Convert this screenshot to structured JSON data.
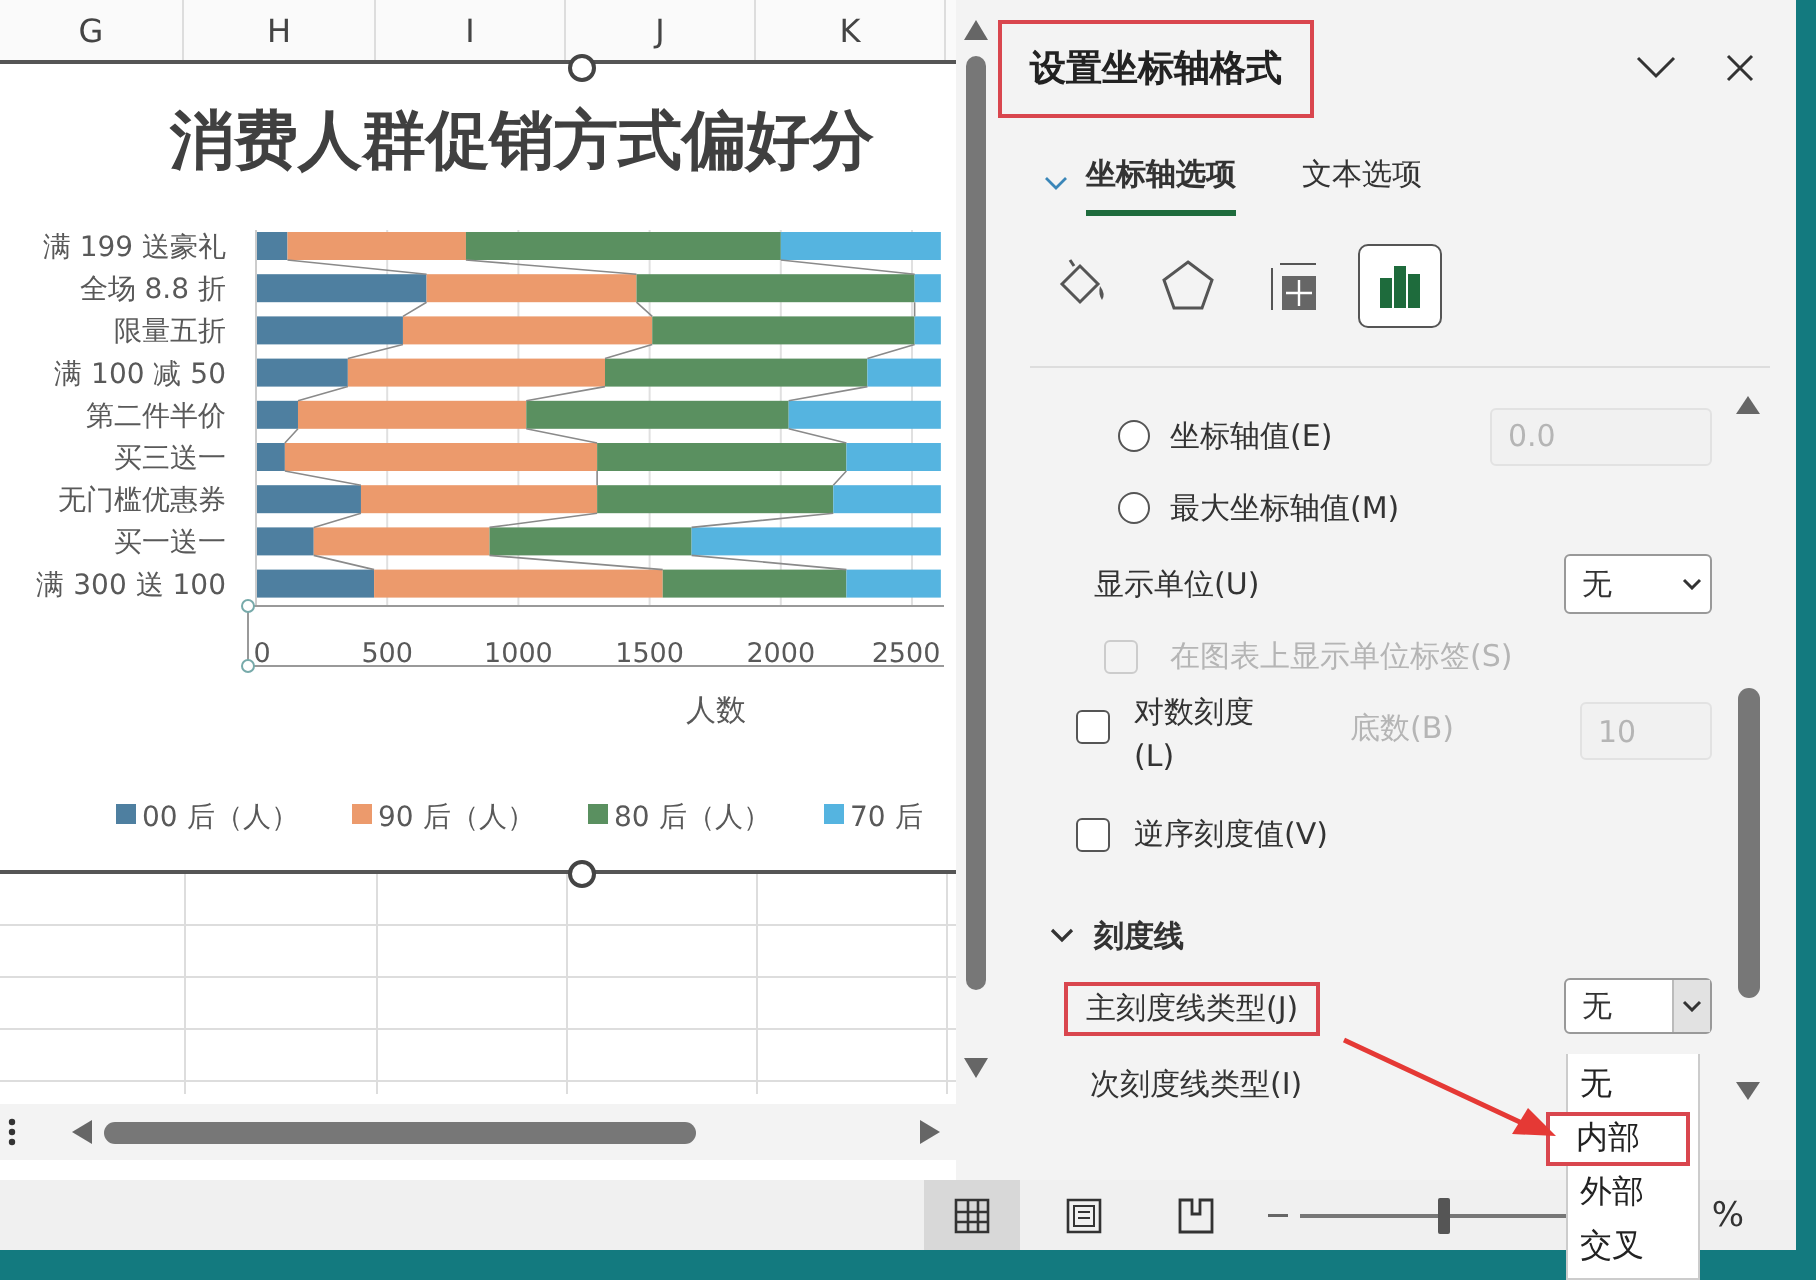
{
  "sheet": {
    "columns": [
      "G",
      "H",
      "I",
      "J",
      "K"
    ],
    "chart": {
      "chart_data": {
        "type": "bar",
        "orientation": "horizontal",
        "stacked": true,
        "title": "消费人群促销方式偏好分",
        "xlabel": "人数",
        "categories": [
          "满 199 送豪礼",
          "全场 8.8 折",
          "限量五折",
          "满 100 减 50",
          "第二件半价",
          "买三送一",
          "无门槛优惠券",
          "买一送一",
          "满 300 送 100"
        ],
        "series": [
          {
            "name": "00 后（人）",
            "color": "#4e7fa0",
            "values": [
              120,
              650,
              560,
              350,
              160,
              110,
              400,
              220,
              450
            ]
          },
          {
            "name": "90 后（人）",
            "color": "#ec9a6c",
            "values": [
              680,
              800,
              950,
              980,
              870,
              1190,
              900,
              670,
              1100
            ]
          },
          {
            "name": "80 后（人）",
            "color": "#5a9060",
            "values": [
              1200,
              1060,
              1000,
              1000,
              1000,
              950,
              900,
              770,
              700
            ]
          },
          {
            "name": "70 后",
            "color": "#55b4e0",
            "values": [
              610,
              100,
              100,
              280,
              580,
              360,
              410,
              950,
              360
            ]
          }
        ],
        "xticks": [
          0,
          500,
          1000,
          1500,
          2000,
          2500
        ],
        "xlim": [
          0,
          2610
        ],
        "grid": true,
        "legend": true
      }
    }
  },
  "pane": {
    "title": "设置坐标轴格式",
    "title_highlighted": true,
    "tabs": [
      {
        "label": "坐标轴选项",
        "selected": true
      },
      {
        "label": "文本选项",
        "selected": false
      }
    ],
    "icon_tabs": [
      {
        "kind": "fill",
        "selected": false
      },
      {
        "kind": "effects",
        "selected": false
      },
      {
        "kind": "size",
        "selected": false
      },
      {
        "kind": "axis",
        "selected": true
      }
    ],
    "options": [
      {
        "kind": "radio",
        "label": "坐标轴值(E)",
        "selected": false,
        "field": {
          "value": "0.0",
          "disabled": true
        }
      },
      {
        "kind": "radio",
        "label": "最大坐标轴值(M)",
        "selected": false
      },
      {
        "kind": "select",
        "label": "显示单位(U)",
        "value": "无",
        "highlighted": false
      },
      {
        "kind": "checkbox",
        "label": "在图表上显示单位标签(S)",
        "checked": false,
        "disabled": true
      },
      {
        "kind": "checkbox",
        "label": "对数刻度(L)",
        "checked": false,
        "disabled": false,
        "extra_label": "底数(B)",
        "field": {
          "value": "10",
          "disabled": true
        }
      },
      {
        "kind": "checkbox",
        "label": "逆序刻度值(V)",
        "checked": false,
        "disabled": false
      },
      {
        "kind": "section",
        "label": "刻度线",
        "expanded": true
      },
      {
        "kind": "select",
        "label": "主刻度线类型(J)",
        "value": "无",
        "highlighted": true
      },
      {
        "kind": "label",
        "label": "次刻度线类型(I)"
      }
    ],
    "dropdown": [
      {
        "label": "无",
        "highlighted": false
      },
      {
        "label": "内部",
        "highlighted": true
      },
      {
        "label": "外部",
        "highlighted": false
      },
      {
        "label": "交叉",
        "highlighted": false
      }
    ]
  },
  "status_bar": {
    "views": [
      {
        "kind": "normal",
        "selected": true
      },
      {
        "kind": "page_layout",
        "selected": false
      },
      {
        "kind": "page_break",
        "selected": false
      }
    ],
    "zoom": {
      "level": 0.54,
      "unit": "%"
    }
  }
}
